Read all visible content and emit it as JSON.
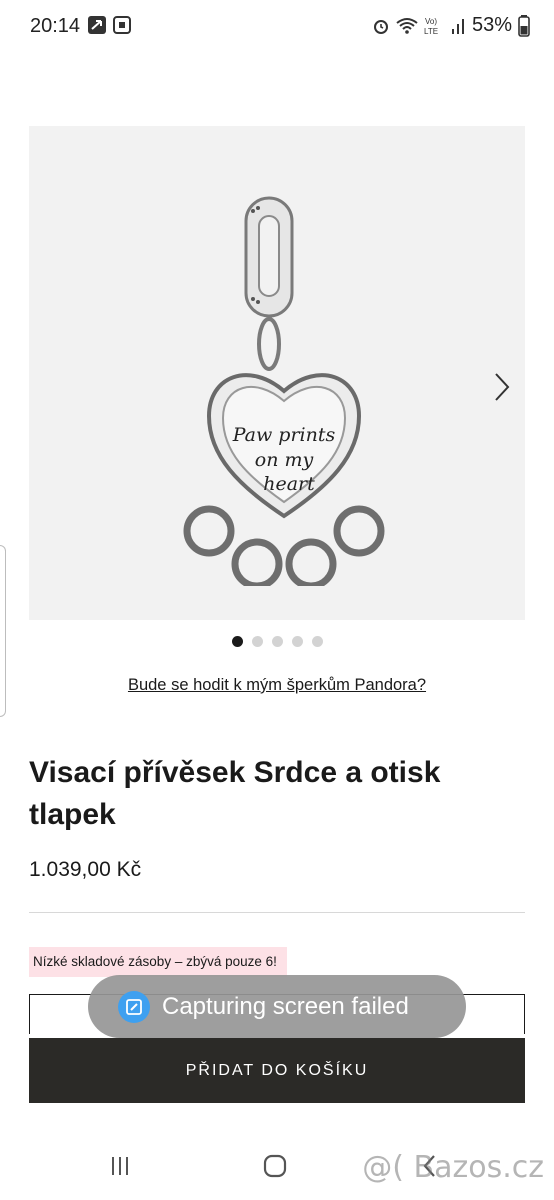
{
  "status_bar": {
    "time": "20:14",
    "battery": "53%",
    "network": "LTE",
    "icons": [
      "navigation-icon",
      "screenshot-icon",
      "alarm-icon",
      "wifi-icon",
      "volte-icon",
      "signal-icon",
      "battery-icon"
    ]
  },
  "gallery": {
    "charm_engraving": [
      "Paw prints",
      "on my",
      "heart"
    ],
    "image_count": 5,
    "active_index": 0
  },
  "product": {
    "fit_link": "Bude se hodit k mým šperkům Pandora?",
    "title": "Visací přívěsek Srdce a otisk tlapek",
    "price": "1.039,00 Kč",
    "stock_notice": "Nízké skladové zásoby – zbývá pouze 6!",
    "add_to_cart": "PŘIDAT DO KOŠÍKU"
  },
  "toast": {
    "message": "Capturing screen failed"
  },
  "watermark": "@( Bazos.cz",
  "colors": {
    "cart_button": "#2b2a27",
    "stock_badge": "#fde1e6",
    "active_dot": "#1a1a1a",
    "inactive_dot": "#d3d3d3",
    "toast_bg": "#969696",
    "toast_icon": "#3ea0f0"
  }
}
